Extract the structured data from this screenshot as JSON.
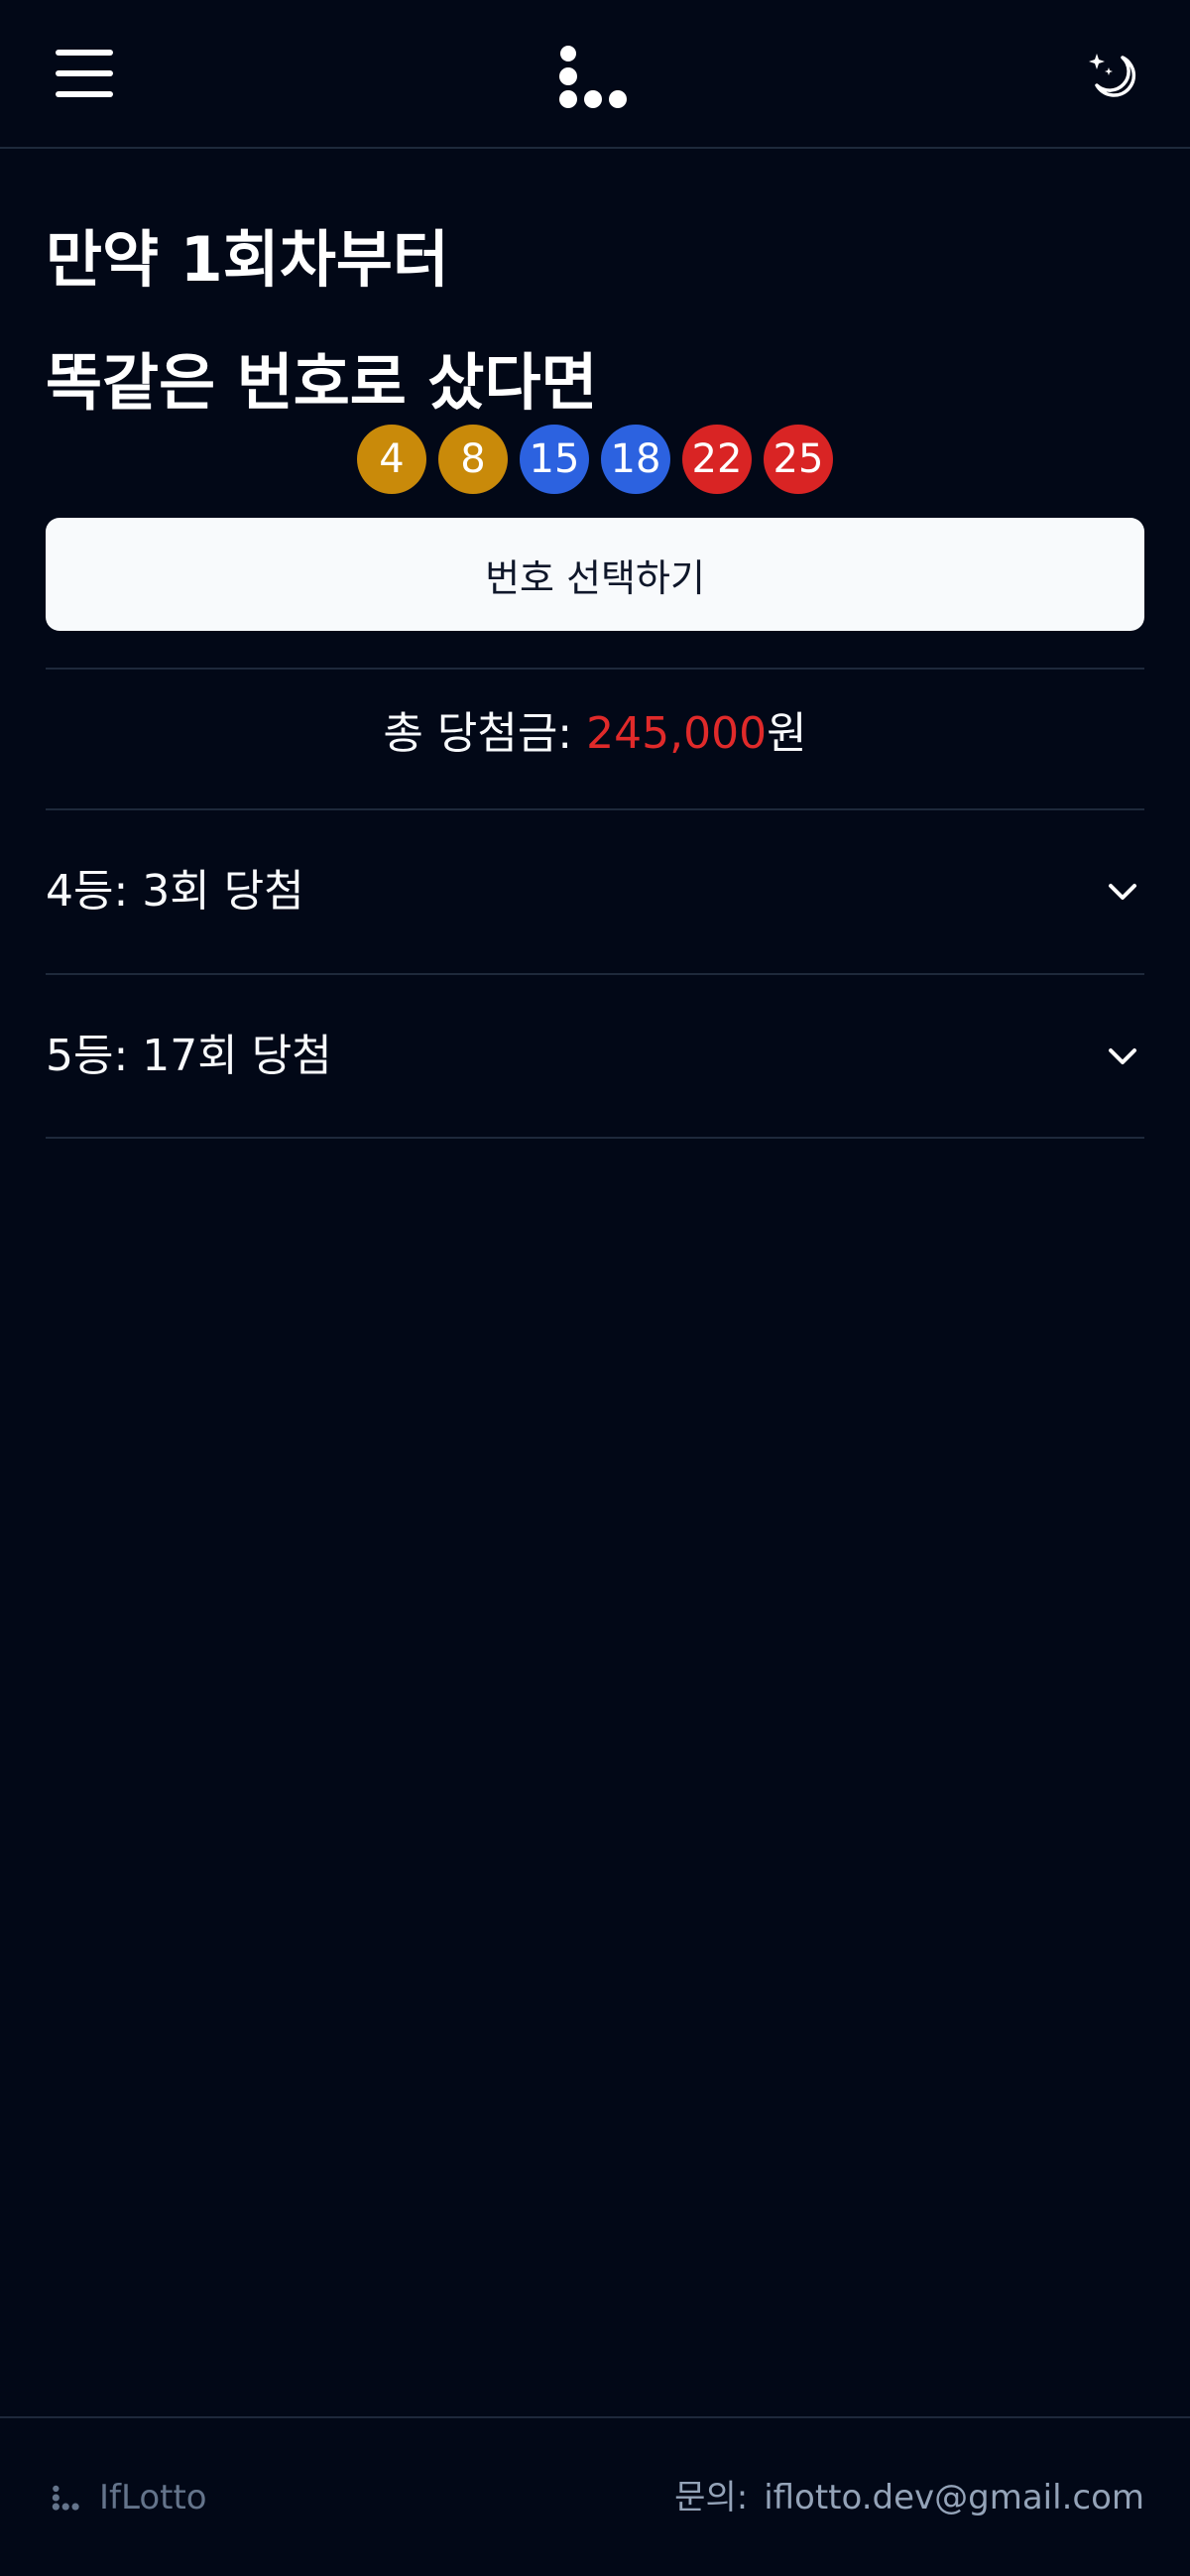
{
  "header": {
    "menu_icon": "hamburger-menu-icon",
    "logo_icon": "iflotto-logo-icon",
    "theme_icon": "moon-stars-icon"
  },
  "title": {
    "line1": "만약 1회차부터",
    "line2": "똑같은 번호로 샀다면"
  },
  "balls": [
    {
      "number": "4",
      "color": "#c98a0a"
    },
    {
      "number": "8",
      "color": "#c98a0a"
    },
    {
      "number": "15",
      "color": "#2c62e0"
    },
    {
      "number": "18",
      "color": "#2c62e0"
    },
    {
      "number": "22",
      "color": "#d92424"
    },
    {
      "number": "25",
      "color": "#d92424"
    }
  ],
  "select_button": {
    "label": "번호 선택하기"
  },
  "total": {
    "label": "총 당첨금:",
    "amount": "245,000",
    "unit": "원",
    "amount_color": "#e02a2a"
  },
  "results": [
    {
      "label": "4등: 3회 당첨",
      "icon": "chevron-down-icon"
    },
    {
      "label": "5등: 17회 당첨",
      "icon": "chevron-down-icon"
    }
  ],
  "footer": {
    "brand": "IfLotto",
    "contact_label": "문의:",
    "contact_email": "iflotto.dev@gmail.com"
  },
  "colors": {
    "background": "#020817",
    "border": "#1e293b",
    "button_bg": "#f8fafc"
  }
}
